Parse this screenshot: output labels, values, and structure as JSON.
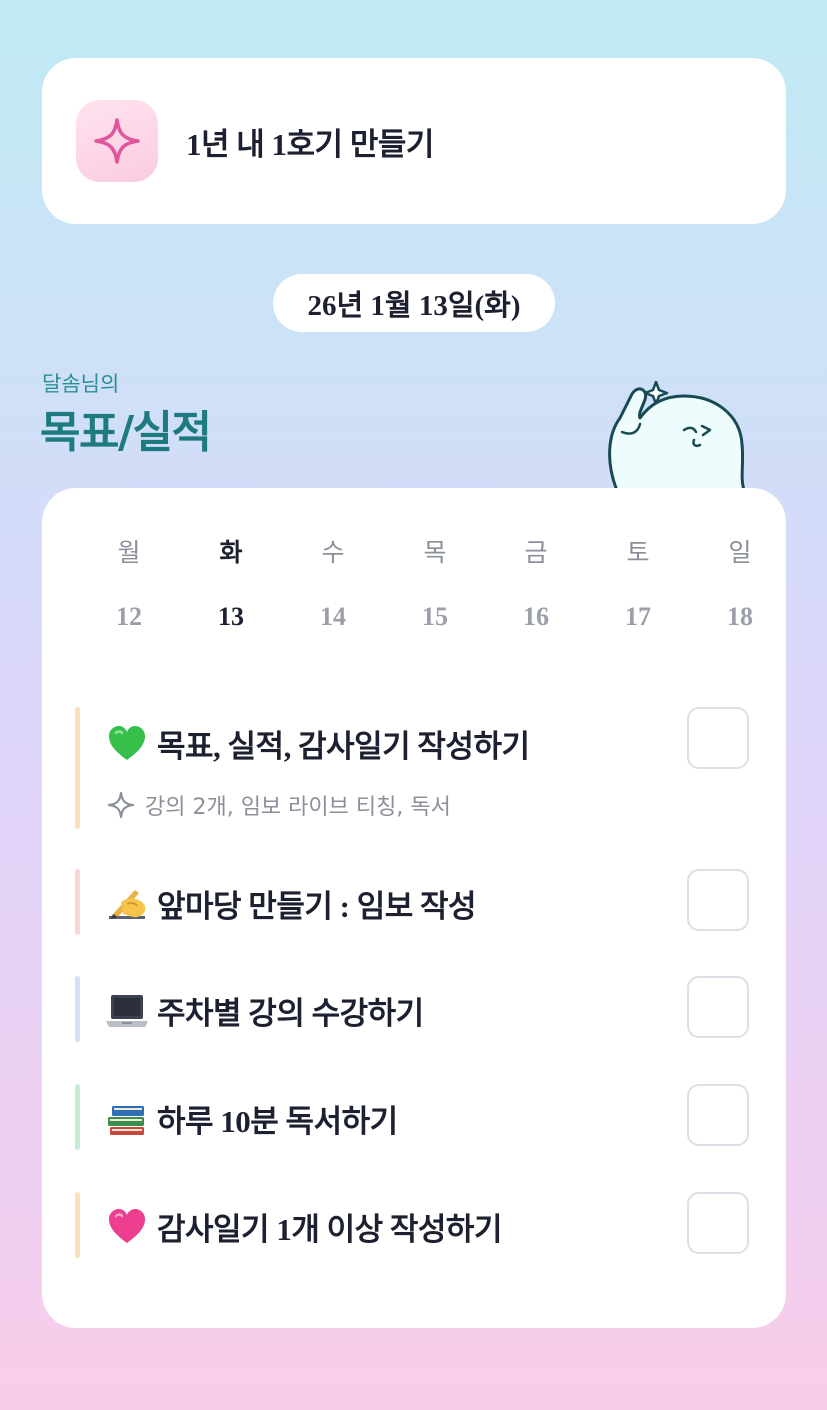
{
  "goal_card": {
    "icon": "sparkle-icon",
    "title": "1년 내 1호기 만들기"
  },
  "date": "26년 1월 13일(화)",
  "section": {
    "owner": "달솜님의",
    "title": "목표/실적",
    "mascot": "mascot-illustration"
  },
  "week": {
    "days": [
      {
        "name": "월",
        "num": "12",
        "active": false
      },
      {
        "name": "화",
        "num": "13",
        "active": true
      },
      {
        "name": "수",
        "num": "14",
        "active": false
      },
      {
        "name": "목",
        "num": "15",
        "active": false
      },
      {
        "name": "금",
        "num": "16",
        "active": false
      },
      {
        "name": "토",
        "num": "17",
        "active": false
      },
      {
        "name": "일",
        "num": "18",
        "active": false
      }
    ]
  },
  "tasks": [
    {
      "emoji": "green-heart-icon",
      "title": "목표, 실적, 감사일기 작성하기",
      "subtitle": "강의 2개, 임보 라이브 티칭, 독서",
      "bar_color": "#fbe0bc",
      "checked": false
    },
    {
      "emoji": "writing-hand-icon",
      "title": "앞마당 만들기 : 임보 작성",
      "subtitle": "",
      "bar_color": "#fbd6d8",
      "checked": false
    },
    {
      "emoji": "laptop-icon",
      "title": "주차별 강의 수강하기",
      "subtitle": "",
      "bar_color": "#d6e0f6",
      "checked": false
    },
    {
      "emoji": "books-icon",
      "title": "하루 10분 독서하기",
      "subtitle": "",
      "bar_color": "#c6ecd6",
      "checked": false
    },
    {
      "emoji": "pink-heart-icon",
      "title": "감사일기 1개 이상 작성하기",
      "subtitle": "",
      "bar_color": "#fbe0bc",
      "checked": false
    }
  ]
}
